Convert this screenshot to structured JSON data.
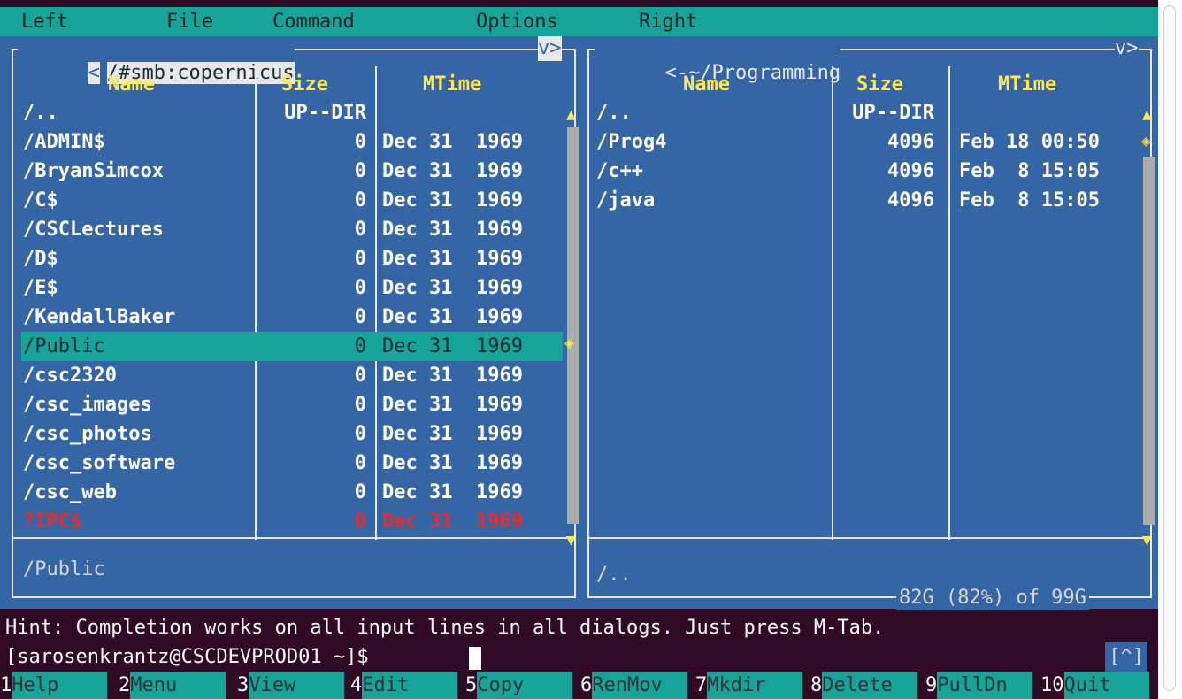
{
  "menu": [
    "Left",
    "File",
    "Command",
    "Options",
    "Right"
  ],
  "left_panel": {
    "path": "/#smb:copernicus",
    "nav_left": "<",
    "nav_right": "v>",
    "headers": {
      "name": "Name",
      "size": "Size",
      "mtime": "MTime"
    },
    "rows": [
      {
        "name": "/..",
        "size": "UP--DIR",
        "mtime": ""
      },
      {
        "name": "/ADMIN$",
        "size": "0",
        "mtime": "Dec 31  1969"
      },
      {
        "name": "/BryanSimcox",
        "size": "0",
        "mtime": "Dec 31  1969"
      },
      {
        "name": "/C$",
        "size": "0",
        "mtime": "Dec 31  1969"
      },
      {
        "name": "/CSCLectures",
        "size": "0",
        "mtime": "Dec 31  1969"
      },
      {
        "name": "/D$",
        "size": "0",
        "mtime": "Dec 31  1969"
      },
      {
        "name": "/E$",
        "size": "0",
        "mtime": "Dec 31  1969"
      },
      {
        "name": "/KendallBaker",
        "size": "0",
        "mtime": "Dec 31  1969"
      },
      {
        "name": "/Public",
        "size": "0",
        "mtime": "Dec 31  1969"
      },
      {
        "name": "/csc2320",
        "size": "0",
        "mtime": "Dec 31  1969"
      },
      {
        "name": "/csc_images",
        "size": "0",
        "mtime": "Dec 31  1969"
      },
      {
        "name": "/csc_photos",
        "size": "0",
        "mtime": "Dec 31  1969"
      },
      {
        "name": "/csc_software",
        "size": "0",
        "mtime": "Dec 31  1969"
      },
      {
        "name": "/csc_web",
        "size": "0",
        "mtime": "Dec 31  1969"
      },
      {
        "name": "?IPC$",
        "size": "0",
        "mtime": "Dec 31  1969"
      }
    ],
    "selected_index": 8,
    "error_index": 14,
    "status": "/Public"
  },
  "right_panel": {
    "path": "~/Programming",
    "nav_left": "<-",
    "nav_right": "v>",
    "headers": {
      "name": "Name",
      "size": "Size",
      "mtime": "MTime"
    },
    "rows": [
      {
        "name": "/..",
        "size": "UP--DIR",
        "mtime": ""
      },
      {
        "name": "/Prog4",
        "size": "4096",
        "mtime": "Feb 18 00:50"
      },
      {
        "name": "/c++",
        "size": "4096",
        "mtime": "Feb  8 15:05"
      },
      {
        "name": "/java",
        "size": "4096",
        "mtime": "Feb  8 15:05"
      }
    ],
    "status": "/..",
    "disk_info": "82G (82%) of 99G"
  },
  "hint": "Hint: Completion works on all input lines in all dialogs. Just press M-Tab.",
  "prompt": "[sarosenkrantz@CSCDEVPROD01 ~]$",
  "caret_button": "[^]",
  "fkeys": [
    {
      "num": "1",
      "label": "Help"
    },
    {
      "num": "2",
      "label": "Menu"
    },
    {
      "num": "3",
      "label": "View"
    },
    {
      "num": "4",
      "label": "Edit"
    },
    {
      "num": "5",
      "label": "Copy"
    },
    {
      "num": "6",
      "label": "RenMov"
    },
    {
      "num": "7",
      "label": "Mkdir"
    },
    {
      "num": "8",
      "label": "Delete"
    },
    {
      "num": "9",
      "label": "PullDn"
    },
    {
      "num": "10",
      "label": "Quit"
    }
  ],
  "colors": {
    "panel_bg": "#3465a4",
    "header_yellow": "#fce94f",
    "selection_teal": "#16a398",
    "error_red": "#ef2929",
    "terminal_bg": "#300a24"
  }
}
